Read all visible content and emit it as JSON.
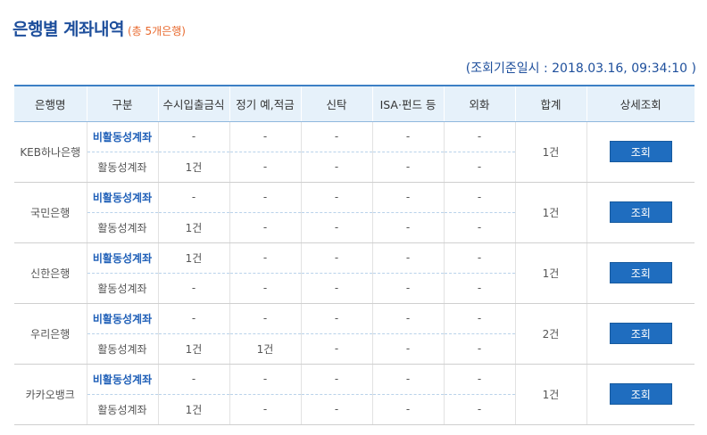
{
  "header": {
    "title": "은행별 계좌내역",
    "count": "(총 5개은행)",
    "timestamp": "(조회기준일시 : 2018.03.16, 09:34:10 )"
  },
  "table": {
    "columns": [
      "은행명",
      "구분",
      "수시입출금식",
      "정기 예,적금",
      "신탁",
      "ISA·펀드 등",
      "외화",
      "합계",
      "상세조회"
    ],
    "banks": [
      {
        "name": "KEB하나은행",
        "rows": [
          {
            "type": "비활동성계좌",
            "values": [
              "-",
              "-",
              "-",
              "-",
              "-"
            ]
          },
          {
            "type": "활동성계좌",
            "values": [
              "1건",
              "-",
              "-",
              "-",
              "-"
            ]
          }
        ],
        "total": "1건",
        "button": "조회"
      },
      {
        "name": "국민은행",
        "rows": [
          {
            "type": "비활동성계좌",
            "values": [
              "-",
              "-",
              "-",
              "-",
              "-"
            ]
          },
          {
            "type": "활동성계좌",
            "values": [
              "1건",
              "-",
              "-",
              "-",
              "-"
            ]
          }
        ],
        "total": "1건",
        "button": "조회"
      },
      {
        "name": "신한은행",
        "rows": [
          {
            "type": "비활동성계좌",
            "values": [
              "1건",
              "-",
              "-",
              "-",
              "-"
            ]
          },
          {
            "type": "활동성계좌",
            "values": [
              "-",
              "-",
              "-",
              "-",
              "-"
            ]
          }
        ],
        "total": "1건",
        "button": "조회"
      },
      {
        "name": "우리은행",
        "rows": [
          {
            "type": "비활동성계좌",
            "values": [
              "-",
              "-",
              "-",
              "-",
              "-"
            ]
          },
          {
            "type": "활동성계좌",
            "values": [
              "1건",
              "1건",
              "-",
              "-",
              "-"
            ]
          }
        ],
        "total": "2건",
        "button": "조회"
      },
      {
        "name": "카카오뱅크",
        "rows": [
          {
            "type": "비활동성계좌",
            "values": [
              "-",
              "-",
              "-",
              "-",
              "-"
            ]
          },
          {
            "type": "활동성계좌",
            "values": [
              "1건",
              "-",
              "-",
              "-",
              "-"
            ]
          }
        ],
        "total": "1건",
        "button": "조회"
      }
    ]
  },
  "colors": {
    "accent": "#1e4f9c",
    "count": "#e86a2f",
    "button": "#1f6dbf",
    "header_bg": "#e6f1fa"
  }
}
